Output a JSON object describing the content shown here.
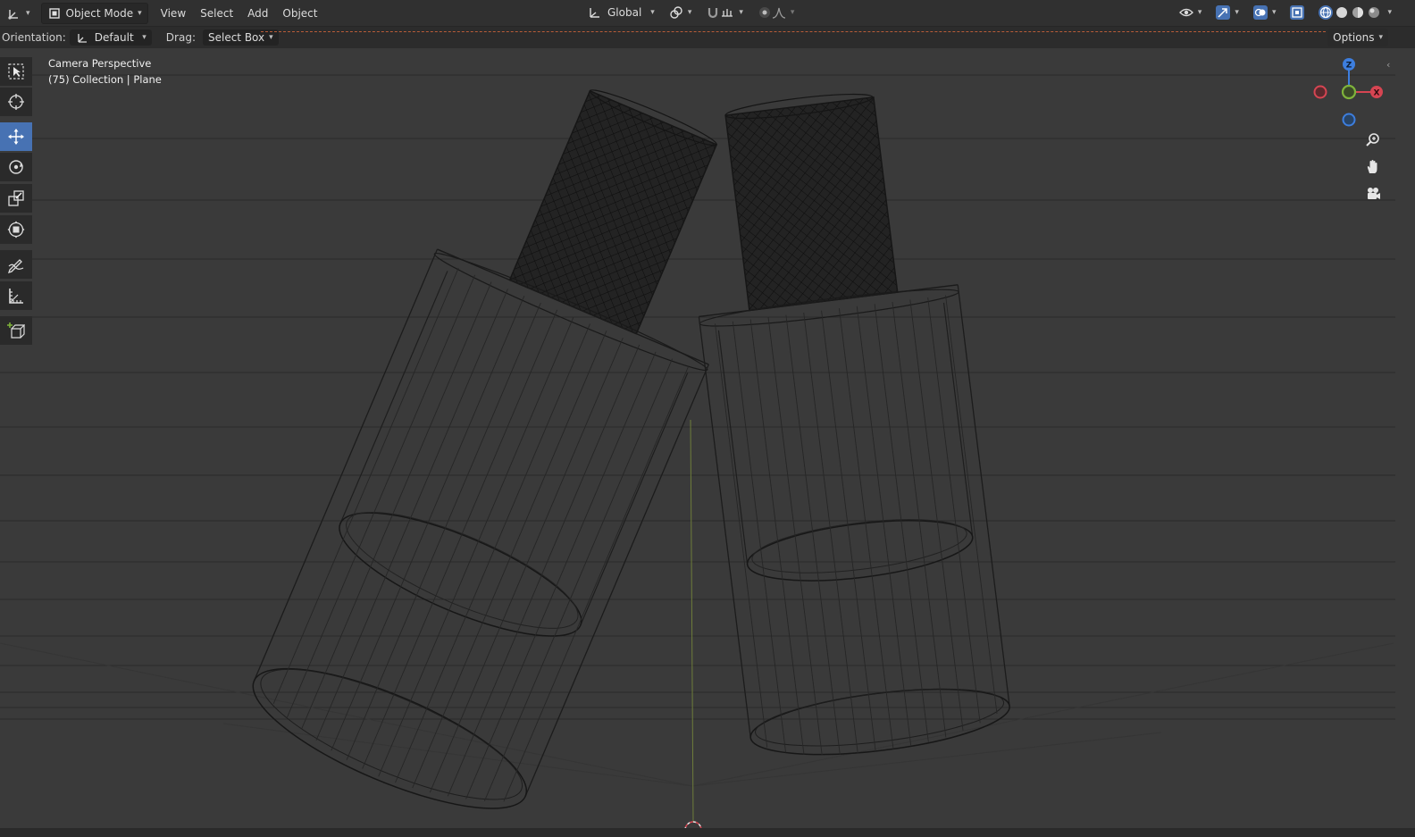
{
  "header": {
    "mode_label": "Object Mode",
    "menus": [
      "View",
      "Select",
      "Add",
      "Object"
    ],
    "transform_space": "Global"
  },
  "tool_settings": {
    "orientation_label": "Orientation:",
    "orientation_value": "Default",
    "drag_label": "Drag:",
    "drag_value": "Select Box",
    "options_label": "Options"
  },
  "viewport": {
    "view_name": "Camera Perspective",
    "collection_info": "(75) Collection | Plane"
  },
  "gizmo": {
    "z_label": "Z",
    "x_label": "X"
  },
  "toolbar": {
    "tools": [
      "select-box-tool",
      "cursor-tool",
      "move-tool",
      "rotate-tool",
      "scale-tool",
      "transform-tool",
      "annotate-tool",
      "measure-tool",
      "add-cube-tool"
    ],
    "active": "move-tool"
  },
  "colors": {
    "x_axis": "#d64552",
    "y_axis": "#7fb33b",
    "z_axis": "#3d7ede",
    "active_tool": "#4772b3",
    "viewport_bg": "#3a3a3a"
  }
}
